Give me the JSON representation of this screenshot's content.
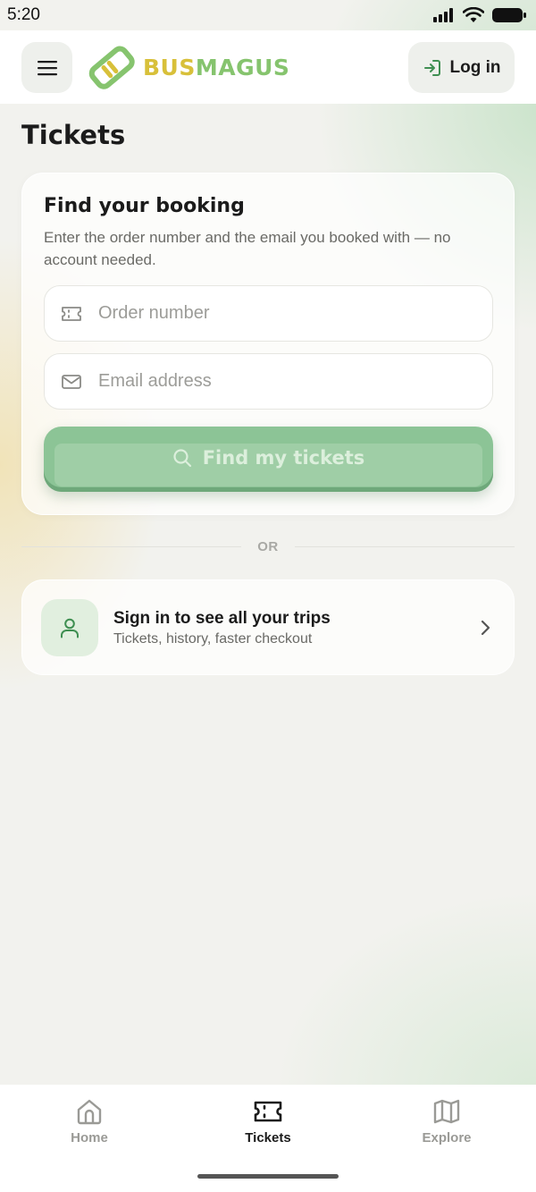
{
  "status_bar": {
    "time": "5:20",
    "icons": [
      "signal-icon",
      "wifi-icon",
      "battery-icon"
    ]
  },
  "header": {
    "menu_icon": "hamburger-menu-icon",
    "logo": {
      "part1": "BUS",
      "part2": "MAGUS"
    },
    "login": {
      "label": "Log in",
      "icon": "login-arrow-icon"
    }
  },
  "page": {
    "title": "Tickets"
  },
  "booking": {
    "title": "Find your booking",
    "description": "Enter the order number and the email you booked with — no account needed.",
    "order_field": {
      "placeholder": "Order number",
      "value": "",
      "icon": "ticket-icon"
    },
    "email_field": {
      "placeholder": "Email address",
      "value": "",
      "icon": "mail-icon"
    },
    "submit": {
      "label": "Find my tickets",
      "icon": "search-icon",
      "enabled": false
    }
  },
  "divider": {
    "text": "OR"
  },
  "signin": {
    "title": "Sign in to see all your trips",
    "subtitle": "Tickets, history, faster checkout",
    "icon": "user-icon"
  },
  "bottom_nav": {
    "items": [
      {
        "label": "Home",
        "icon": "home-icon",
        "active": false
      },
      {
        "label": "Tickets",
        "icon": "ticket-icon",
        "active": true
      },
      {
        "label": "Explore",
        "icon": "map-icon",
        "active": false
      }
    ]
  },
  "colors": {
    "brand_green": "#3f8f52",
    "brand_yellow": "#d8c03a",
    "light_green": "#86c46e",
    "button_green": "#8cc496",
    "inactive_nav": "#9a9a96",
    "active_nav": "#1b1b1b"
  }
}
